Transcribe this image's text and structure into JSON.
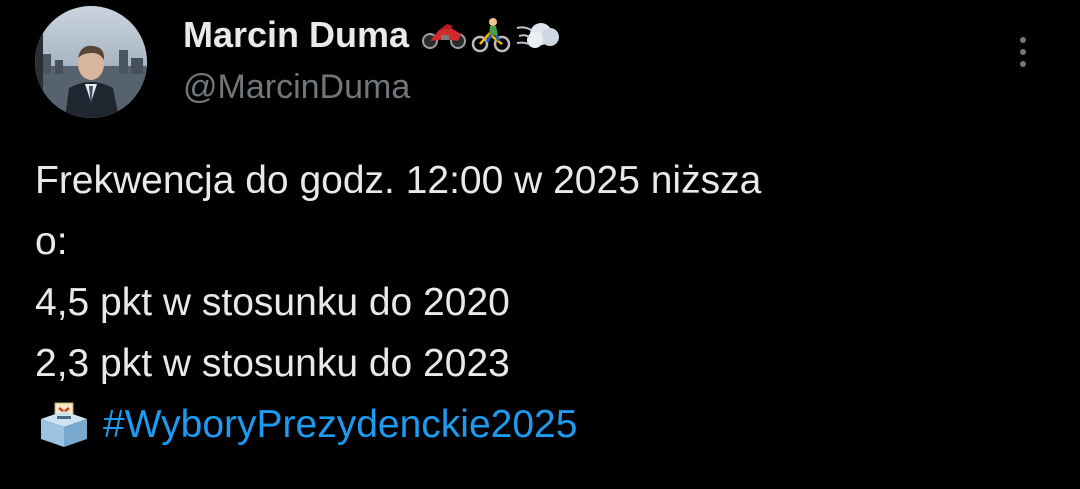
{
  "tweet": {
    "author": {
      "display_name": "Marcin Duma",
      "name_emojis": [
        "motorcycle-emoji",
        "cyclist-emoji",
        "dash-emoji"
      ],
      "handle": "@MarcinDuma"
    },
    "body": {
      "line1": "Frekwencja do godz. 12:00 w 2025 niższa",
      "line2": "o:",
      "line3": "4,5 pkt w stosunku do 2020",
      "line4": "2,3 pkt w stosunku do 2023",
      "ballot_icon": "ballot-box-emoji",
      "hashtag": "#WyboryPrezydenckie2025"
    },
    "more_icon": "more-vertical-icon"
  },
  "colors": {
    "background": "#000000",
    "text": "#e7e9ea",
    "secondary": "#71767b",
    "link": "#1d9bf0"
  }
}
